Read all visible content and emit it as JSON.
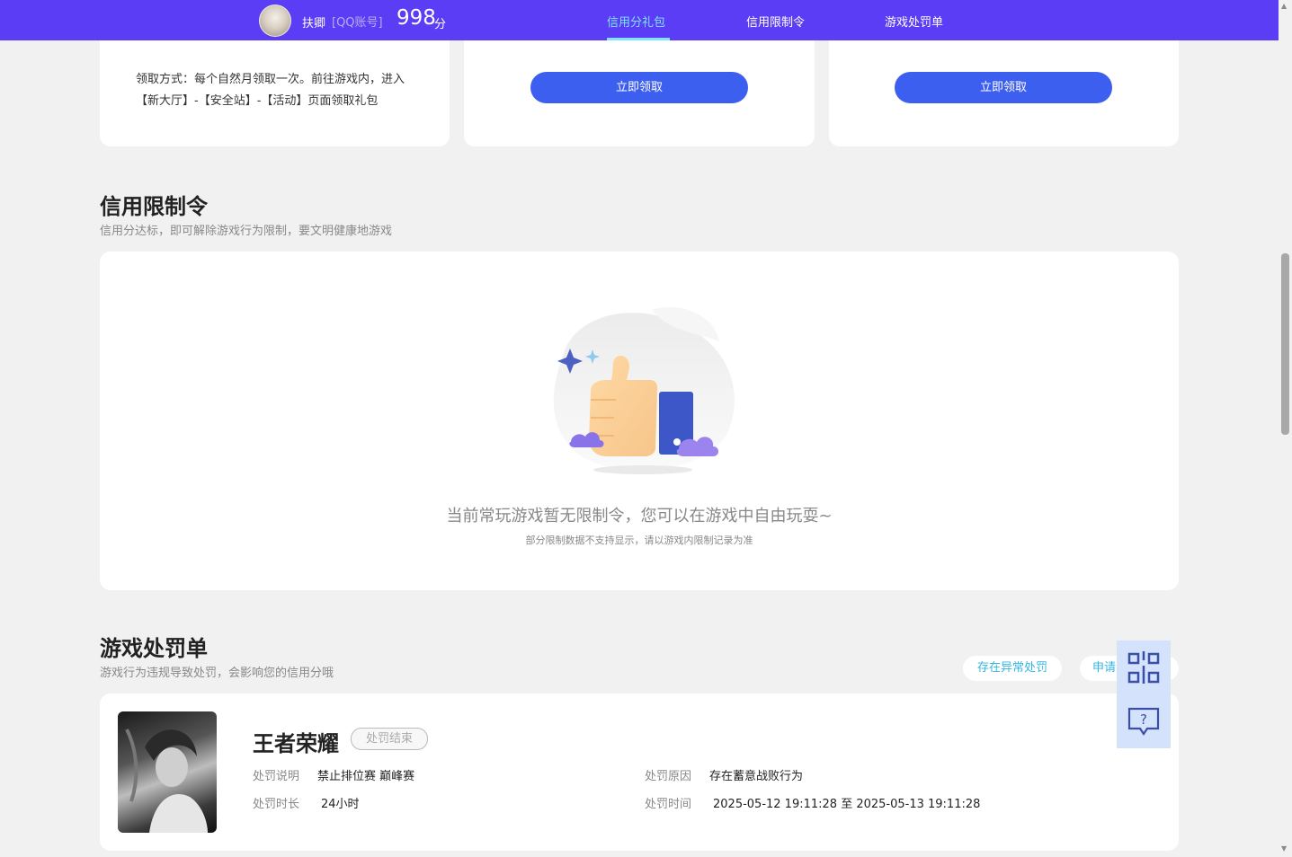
{
  "header": {
    "user_name": "扶卿",
    "account_type": "[QQ账号]",
    "score": "998",
    "score_unit": "分",
    "tabs": [
      {
        "label": "信用分礼包"
      },
      {
        "label": "信用限制令"
      },
      {
        "label": "游戏处罚单"
      }
    ]
  },
  "gift_cards": {
    "claim_method": "领取方式：每个自然月领取一次。前往游戏内，进入【新大厅】-【安全站】-【活动】页面领取礼包",
    "claim_button_1": "立即领取",
    "claim_button_2": "立即领取"
  },
  "restriction": {
    "title": "信用限制令",
    "subtitle": "信用分达标，即可解除游戏行为限制，要文明健康地游戏",
    "empty_message": "当前常玩游戏暂无限制令，您可以在游戏中自由玩耍~",
    "empty_note": "部分限制数据不支持显示，请以游戏内限制记录为准"
  },
  "penalty": {
    "title": "游戏处罚单",
    "subtitle": "游戏行为违规导致处罚，会影响您的信用分哦",
    "abnormal_button": "存在异常处罚",
    "appeal_button": "申请",
    "item": {
      "game_name": "王者荣耀",
      "status": "处罚结束",
      "desc_label": "处罚说明",
      "desc_value": "禁止排位赛 巅峰赛",
      "duration_label": "处罚时长",
      "duration_value": "24小时",
      "reason_label": "处罚原因",
      "reason_value": "存在蓄意战败行为",
      "time_label": "处罚时间",
      "time_value": "2025-05-12 19:11:28 至 2025-05-13 19:11:28"
    }
  },
  "colors": {
    "header_bg": "#5a3df5",
    "active_tab": "#7de3ff",
    "primary_button": "#3c5ff0"
  }
}
